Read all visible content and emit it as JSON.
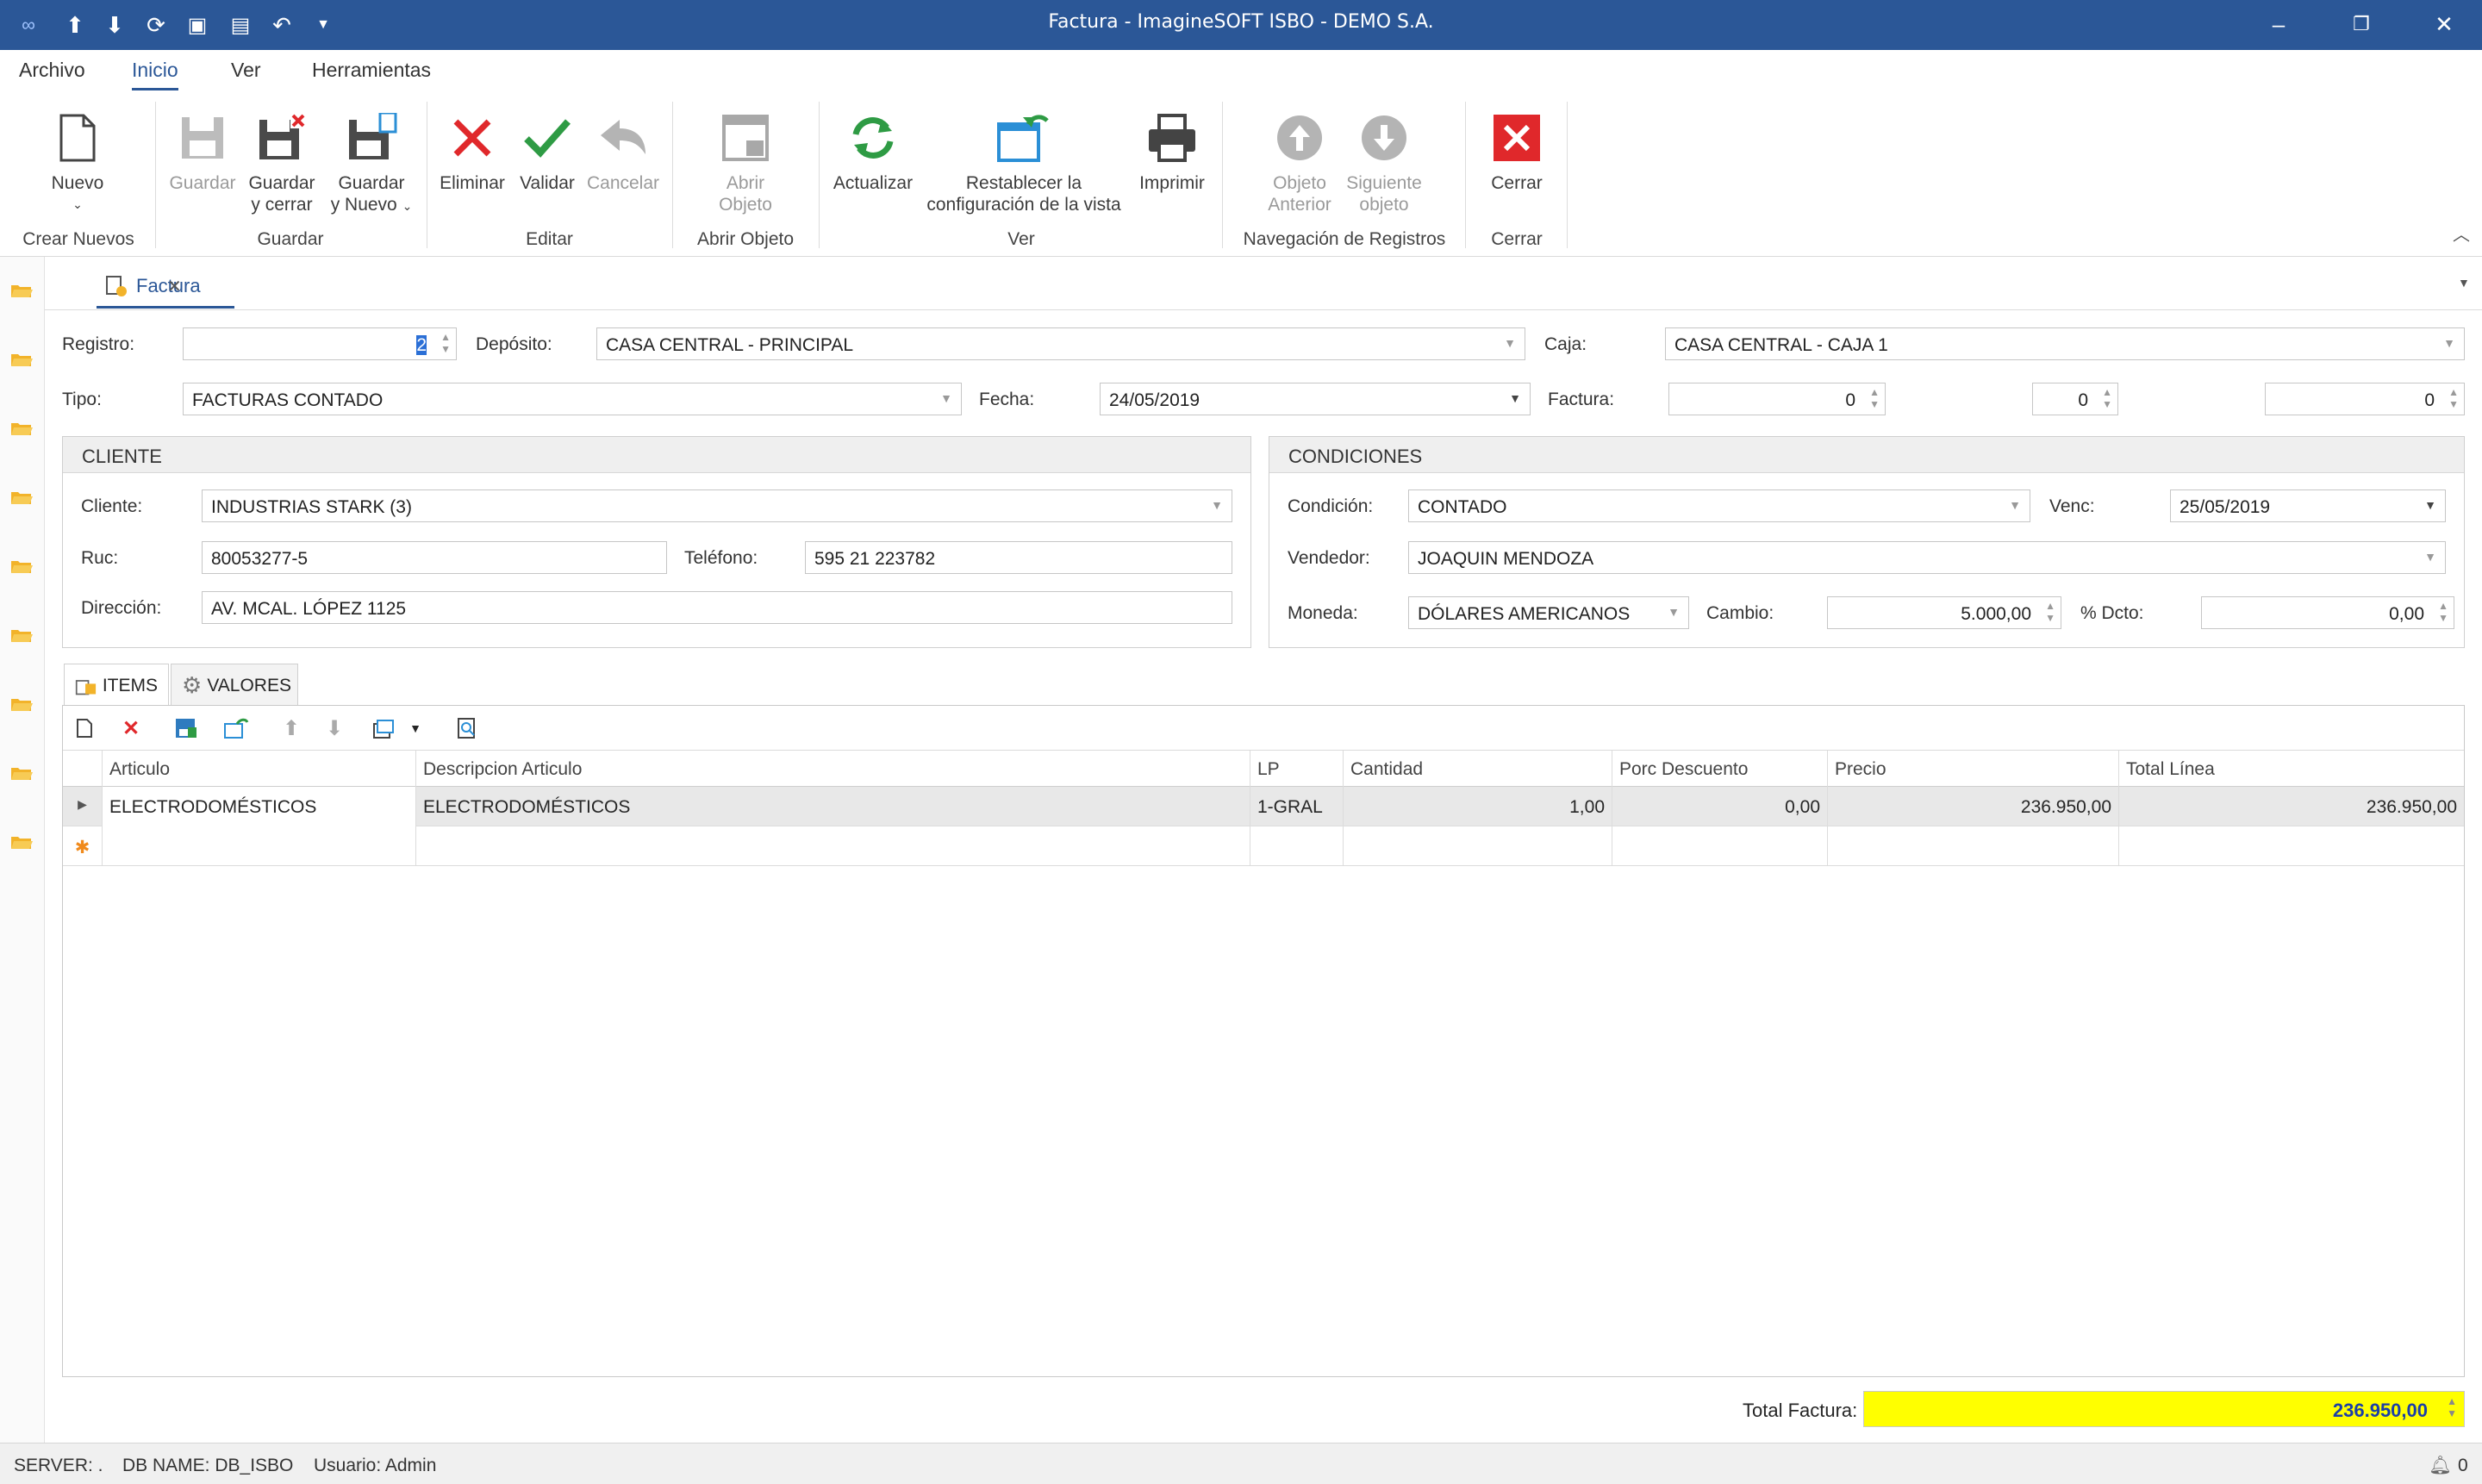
{
  "window": {
    "title": "Factura - ImagineSOFT ISBO - DEMO S.A."
  },
  "menu": [
    "Archivo",
    "Inicio",
    "Ver",
    "Herramientas"
  ],
  "ribbon": {
    "nuevo": "Nuevo",
    "guardar": "Guardar",
    "guardar_cerrar_1": "Guardar",
    "guardar_cerrar_2": "y cerrar",
    "guardar_nuevo_1": "Guardar",
    "guardar_nuevo_2": "y Nuevo",
    "eliminar": "Eliminar",
    "validar": "Validar",
    "cancelar": "Cancelar",
    "abrir_1": "Abrir",
    "abrir_2": "Objeto",
    "actualizar": "Actualizar",
    "restablecer_1": "Restablecer la",
    "restablecer_2": "configuración de la vista",
    "imprimir": "Imprimir",
    "anterior_1": "Objeto",
    "anterior_2": "Anterior",
    "siguiente_1": "Siguiente",
    "siguiente_2": "objeto",
    "cerrar": "Cerrar",
    "groups": [
      "Crear Nuevos",
      "Guardar",
      "Editar",
      "Abrir Objeto",
      "Ver",
      "Navegación de Registros",
      "Cerrar"
    ]
  },
  "doc_tab": "Factura",
  "header": {
    "registro_label": "Registro:",
    "registro_value": "2",
    "deposito_label": "Depósito:",
    "deposito_value": "CASA CENTRAL - PRINCIPAL",
    "caja_label": "Caja:",
    "caja_value": "CASA CENTRAL - CAJA 1",
    "tipo_label": "Tipo:",
    "tipo_value": "FACTURAS CONTADO",
    "fecha_label": "Fecha:",
    "fecha_value": "24/05/2019",
    "factura_label": "Factura:",
    "factura_1": "0",
    "factura_2": "0",
    "factura_3": "0"
  },
  "cliente": {
    "title": "CLIENTE",
    "cliente_label": "Cliente:",
    "cliente_value": "INDUSTRIAS STARK (3)",
    "ruc_label": "Ruc:",
    "ruc_value": "80053277-5",
    "telefono_label": "Teléfono:",
    "telefono_value": "595 21 223782",
    "direccion_label": "Dirección:",
    "direccion_value": "AV. MCAL. LÓPEZ 1125"
  },
  "condiciones": {
    "title": "CONDICIONES",
    "condicion_label": "Condición:",
    "condicion_value": "CONTADO",
    "venc_label": "Venc:",
    "venc_value": "25/05/2019",
    "vendedor_label": "Vendedor:",
    "vendedor_value": "JOAQUIN MENDOZA",
    "moneda_label": "Moneda:",
    "moneda_value": "DÓLARES AMERICANOS",
    "cambio_label": "Cambio:",
    "cambio_value": "5.000,00",
    "dcto_label": "% Dcto:",
    "dcto_value": "0,00"
  },
  "tabs": {
    "items": "ITEMS",
    "valores": "VALORES"
  },
  "grid": {
    "columns": [
      "Articulo",
      "Descripcion Articulo",
      "LP",
      "Cantidad",
      "Porc Descuento",
      "Precio",
      "Total Línea"
    ],
    "rows": [
      [
        "ELECTRODOMÉSTICOS",
        "ELECTRODOMÉSTICOS",
        "1-GRAL",
        "1,00",
        "0,00",
        "236.950,00",
        "236.950,00"
      ]
    ]
  },
  "total": {
    "label": "Total Factura:",
    "value": "236.950,00"
  },
  "status": {
    "server": "SERVER: .",
    "db": "DB NAME: DB_ISBO",
    "user": "Usuario: Admin",
    "notif": "0"
  },
  "colors": {
    "titlebar": "#2b5797",
    "total_bg": "#ffff00"
  }
}
